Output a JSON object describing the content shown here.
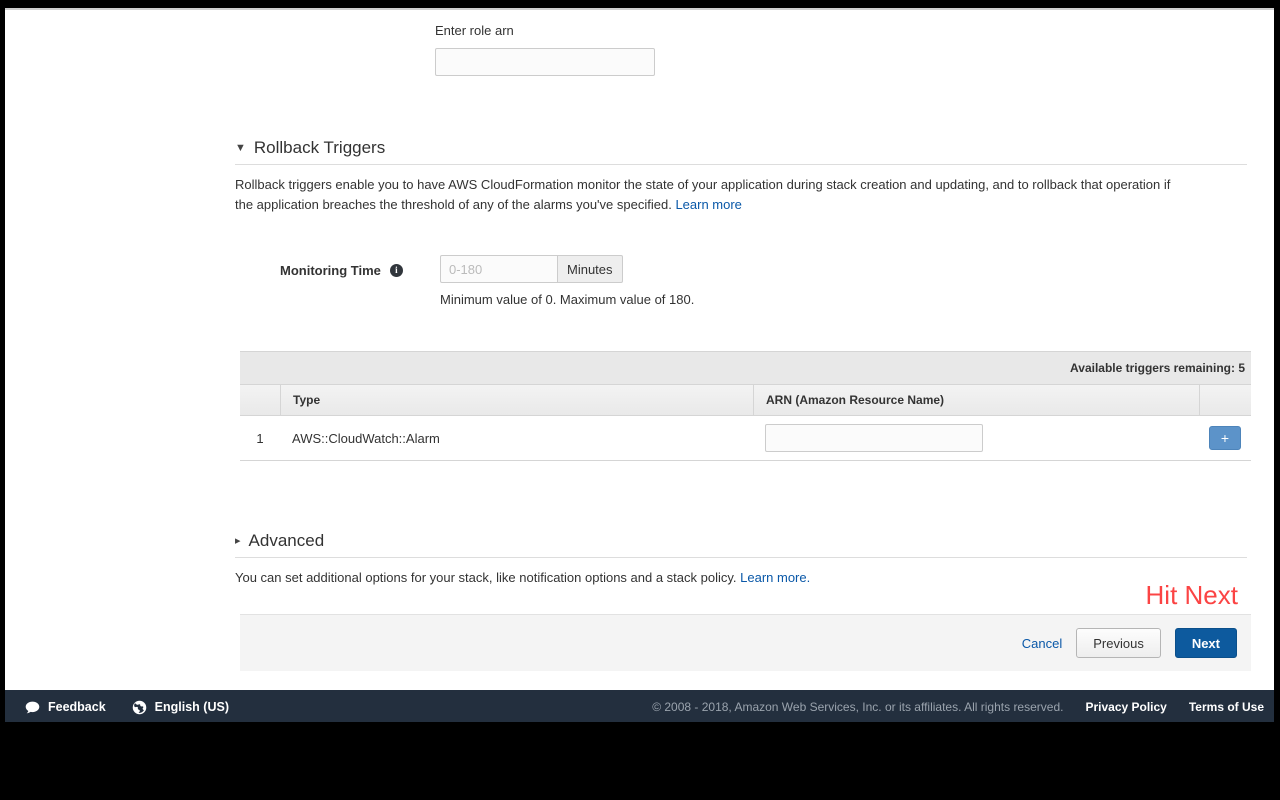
{
  "role_arn": {
    "label": "Enter role arn",
    "value": "",
    "placeholder": ""
  },
  "rollback_triggers": {
    "caret": "▼",
    "title": "Rollback Triggers",
    "description": "Rollback triggers enable you to have AWS CloudFormation monitor the state of your application during stack creation and updating, and to rollback that operation if the application breaches the threshold of any of the alarms you've specified.",
    "learn_more": "Learn more",
    "monitoring": {
      "label": "Monitoring Time",
      "info_glyph": "i",
      "placeholder": "0-180",
      "value": "",
      "unit": "Minutes",
      "hint": "Minimum value of 0. Maximum value of 180."
    },
    "table": {
      "remaining_label": "Available triggers remaining: 5",
      "headers": [
        "",
        "Type",
        "ARN (Amazon Resource Name)",
        ""
      ],
      "rows": [
        {
          "index": "1",
          "type": "AWS::CloudWatch::Alarm",
          "arn_value": "",
          "arn_placeholder": "",
          "add_label": "+"
        }
      ]
    }
  },
  "advanced": {
    "caret": "▸",
    "title": "Advanced",
    "description": "You can set additional options for your stack, like notification options and a stack policy.",
    "learn_more": "Learn more."
  },
  "annotation": {
    "text": "Hit Next",
    "color": "#fb4444"
  },
  "actions": {
    "cancel": "Cancel",
    "previous": "Previous",
    "next": "Next"
  },
  "footer": {
    "feedback": "Feedback",
    "language": "English (US)",
    "copyright": "© 2008 - 2018, Amazon Web Services, Inc. or its affiliates. All rights reserved.",
    "privacy": "Privacy Policy",
    "terms": "Terms of Use"
  },
  "colors": {
    "link": "#0a58a8",
    "primary_button": "#0d5a9e",
    "footer_bar": "#232f3e",
    "add_button": "#5c93c9",
    "annotation": "#fb4444"
  }
}
